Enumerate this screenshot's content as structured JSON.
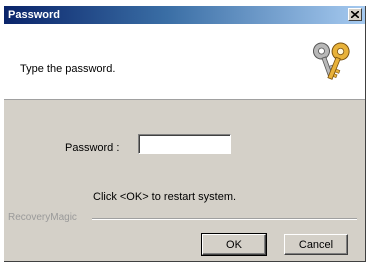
{
  "window": {
    "title": "Password"
  },
  "header": {
    "instruction": "Type the password.",
    "icon": "keys-icon"
  },
  "form": {
    "password_label": "Password :",
    "password_value": "",
    "hint": "Click <OK> to restart system."
  },
  "footer": {
    "brand": "RecoveryMagic"
  },
  "buttons": {
    "ok_label": "OK",
    "cancel_label": "Cancel"
  },
  "colors": {
    "title_start": "#0a246a",
    "title_end": "#a6caf0",
    "dialog_face": "#d4d0c8"
  }
}
